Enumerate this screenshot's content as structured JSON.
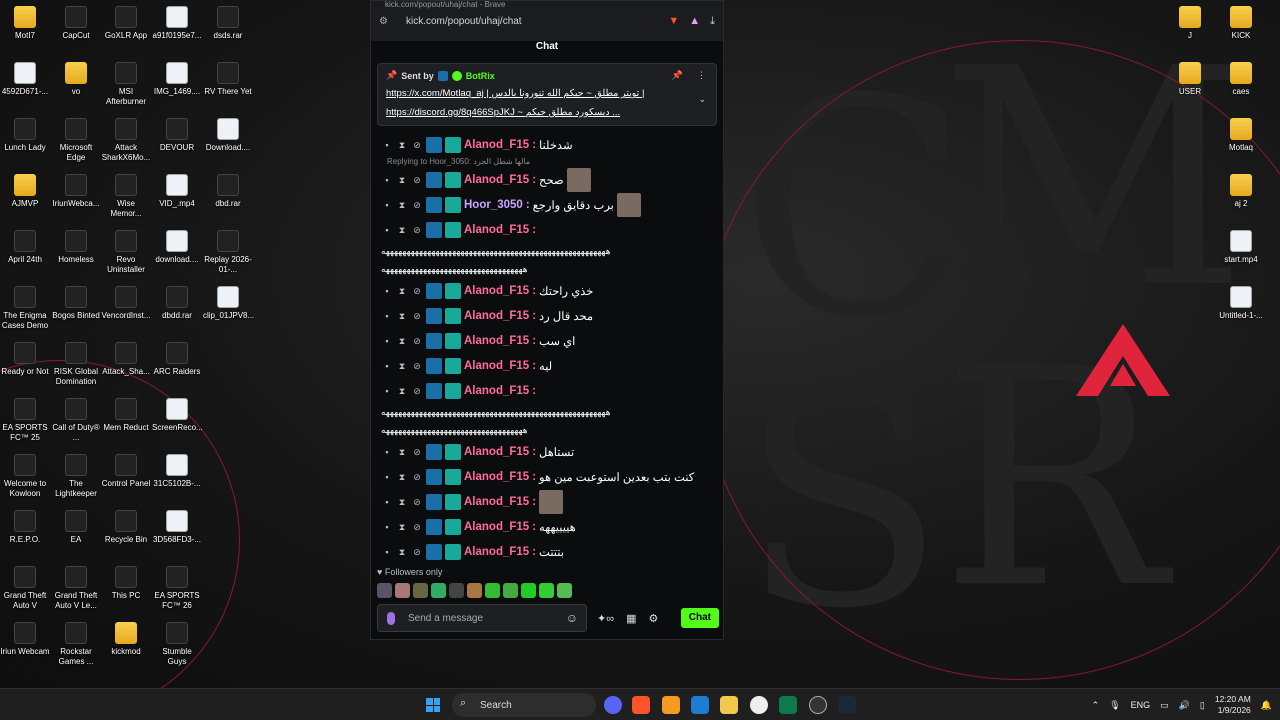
{
  "desktop": {
    "icons_left": [
      {
        "label": "MotI7",
        "type": "folder"
      },
      {
        "label": "CapCut",
        "type": "app"
      },
      {
        "label": "GoXLR App",
        "type": "app"
      },
      {
        "label": "a91f0195e7...",
        "type": "file"
      },
      {
        "label": "dsds.rar",
        "type": "rar"
      },
      {
        "label": "4592D671-...",
        "type": "file"
      },
      {
        "label": "vo",
        "type": "folder"
      },
      {
        "label": "MSI Afterburner",
        "type": "app"
      },
      {
        "label": "IMG_1469....",
        "type": "file"
      },
      {
        "label": "RV There Yet",
        "type": "app"
      },
      {
        "label": "Lunch Lady",
        "type": "app"
      },
      {
        "label": "Microsoft Edge",
        "type": "app"
      },
      {
        "label": "Attack SharkX6Mo...",
        "type": "app"
      },
      {
        "label": "DEVOUR",
        "type": "app"
      },
      {
        "label": "Download....",
        "type": "file"
      },
      {
        "label": "AJMVP",
        "type": "folder"
      },
      {
        "label": "IriunWebca...",
        "type": "app"
      },
      {
        "label": "Wise Memor...",
        "type": "app"
      },
      {
        "label": "VID_.mp4",
        "type": "file"
      },
      {
        "label": "dbd.rar",
        "type": "rar"
      },
      {
        "label": "April 24th",
        "type": "app"
      },
      {
        "label": "Homeless",
        "type": "app"
      },
      {
        "label": "Revo Uninstaller",
        "type": "app"
      },
      {
        "label": "download....",
        "type": "file"
      },
      {
        "label": "Replay 2026-01-...",
        "type": "app"
      },
      {
        "label": "The Enigma Cases Demo",
        "type": "app"
      },
      {
        "label": "Bogos Binted",
        "type": "app"
      },
      {
        "label": "VencordInst...",
        "type": "app"
      },
      {
        "label": "dbdd.rar",
        "type": "rar"
      },
      {
        "label": "clip_01JPV8...",
        "type": "file"
      },
      {
        "label": "Ready or Not",
        "type": "app"
      },
      {
        "label": "RISK Global Domination",
        "type": "app"
      },
      {
        "label": "Attack_Sha...",
        "type": "app"
      },
      {
        "label": "ARC Raiders",
        "type": "app"
      },
      {
        "label": "EA SPORTS FC™ 25",
        "type": "app"
      },
      {
        "label": "Call of Duty® ...",
        "type": "app"
      },
      {
        "label": "Mem Reduct",
        "type": "app"
      },
      {
        "label": "ScreenReco...",
        "type": "file"
      },
      {
        "label": "Welcome to Kowloon",
        "type": "app"
      },
      {
        "label": "The Lightkeeper",
        "type": "app"
      },
      {
        "label": "Control Panel",
        "type": "app"
      },
      {
        "label": "31C5102B-...",
        "type": "file"
      },
      {
        "label": "R.E.P.O.",
        "type": "app"
      },
      {
        "label": "EA",
        "type": "app"
      },
      {
        "label": "Recycle Bin",
        "type": "app"
      },
      {
        "label": "3D568FD3-...",
        "type": "file"
      },
      {
        "label": "Grand Theft Auto V",
        "type": "app"
      },
      {
        "label": "Grand Theft Auto V Le...",
        "type": "app"
      },
      {
        "label": "This PC",
        "type": "app"
      },
      {
        "label": "EA SPORTS FC™ 26",
        "type": "app"
      },
      {
        "label": "Iriun Webcam",
        "type": "app"
      },
      {
        "label": "Rockstar Games ...",
        "type": "app"
      },
      {
        "label": "kickmod",
        "type": "folder"
      },
      {
        "label": "Stumble Guys",
        "type": "app"
      }
    ],
    "icons_right": [
      {
        "label": "J",
        "type": "folder"
      },
      {
        "label": "KICK",
        "type": "folder"
      },
      {
        "label": "USER",
        "type": "folder"
      },
      {
        "label": "caes",
        "type": "folder"
      },
      {
        "label": "Motlaq",
        "type": "folder"
      },
      {
        "label": "aj 2",
        "type": "folder"
      },
      {
        "label": "start.mp4",
        "type": "file"
      },
      {
        "label": "Untitled-1-...",
        "type": "file"
      }
    ]
  },
  "browser": {
    "tab_title": "kick.com/popout/uhaj/chat - Brave",
    "url": "kick.com/popout/uhaj/chat"
  },
  "chat": {
    "header": "Chat",
    "pinned": {
      "sent_by_label": "Sent by",
      "bot_name": "BotRix",
      "line1": "https://x.com/Motlaq_aj | تويتر مطلق ~ حيكم الله تنورونا بالدس |",
      "line2": "https://discord.gg/8q466SpJKJ ~ ديسكورد مطلق حيكم ..."
    },
    "top_partial_user": "Hoor_3050",
    "reply_note": "Replying to Hoor_3050: مالها شطل الجرد",
    "messages": [
      {
        "user": "Alanod_F15",
        "color": "alanod",
        "text": "شدخلنا"
      },
      {
        "user": "Alanod_F15",
        "color": "alanod",
        "text": "صحح",
        "emote": true
      },
      {
        "user": "Hoor_3050",
        "color": "hoor",
        "text": "برب دقايق وارجع",
        "emote": true
      },
      {
        "user": "Alanod_F15",
        "color": "alanod",
        "text": ""
      },
      {
        "user": "Alanod_F15",
        "color": "alanod",
        "text": "خذي راحتك"
      },
      {
        "user": "Alanod_F15",
        "color": "alanod",
        "text": "محد قال رد"
      },
      {
        "user": "Alanod_F15",
        "color": "alanod",
        "text": "اي سب"
      },
      {
        "user": "Alanod_F15",
        "color": "alanod",
        "text": "ليه"
      },
      {
        "user": "Alanod_F15",
        "color": "alanod",
        "text": ""
      },
      {
        "user": "Alanod_F15",
        "color": "alanod",
        "text": "تستاهل"
      },
      {
        "user": "Alanod_F15",
        "color": "alanod",
        "text": "كنت بتب بعدين استوعبت مين هو"
      },
      {
        "user": "Alanod_F15",
        "color": "alanod",
        "text": "",
        "emote": true
      },
      {
        "user": "Alanod_F15",
        "color": "alanod",
        "text": "هييييههه"
      },
      {
        "user": "Alanod_F15",
        "color": "alanod",
        "text": "بتتتت"
      }
    ],
    "long_line": "ههههههههههههههههههههههههههههههههههههههههههههههههههههههه",
    "long_line_2": "ههههههههههههههههههههههههههههههههههه",
    "followers_only": "Followers only",
    "input_placeholder": "Send a message",
    "send_button": "Chat"
  },
  "taskbar": {
    "search_label": "Search",
    "language": "ENG",
    "time": "12:20 AM",
    "date": "1/9/2026"
  },
  "colors": {
    "kick_green": "#53fc18",
    "alanod": "#ff6b9a",
    "hoor": "#c6a5ff"
  }
}
